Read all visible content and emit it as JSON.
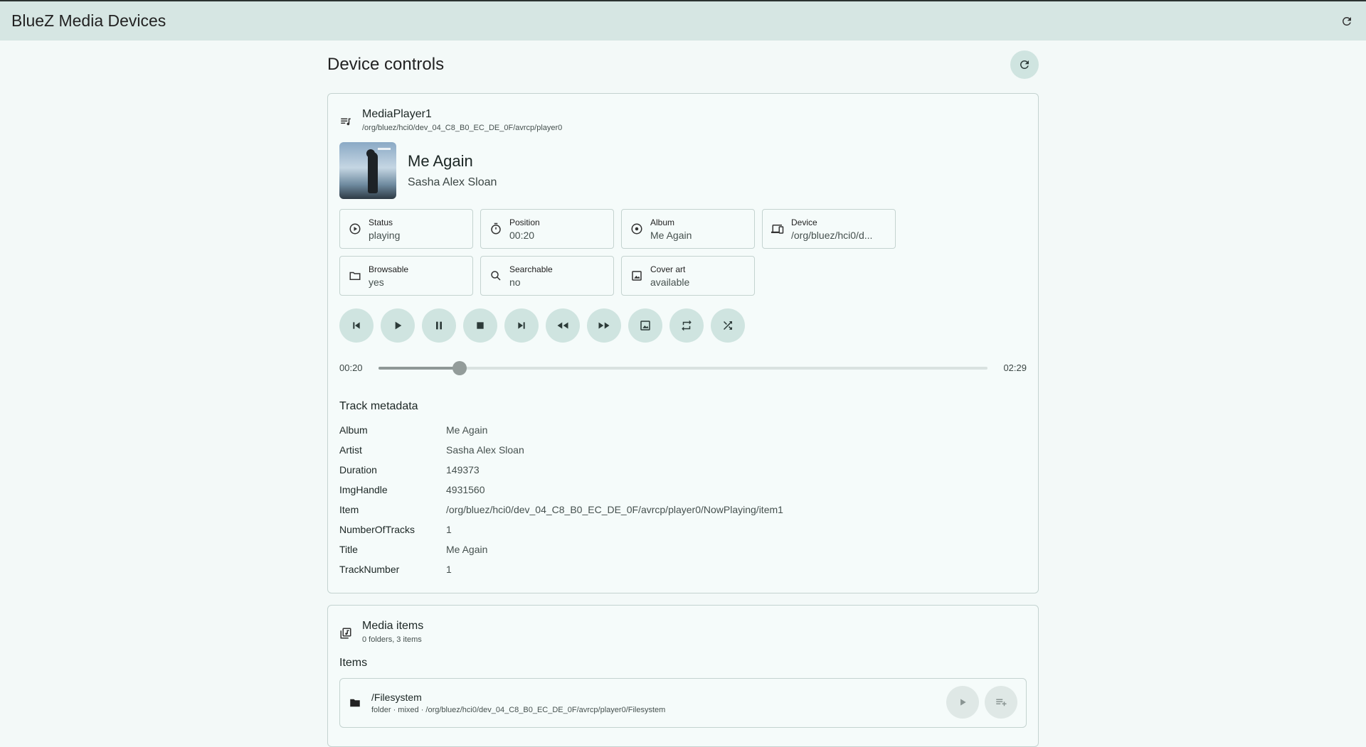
{
  "app": {
    "title": "BlueZ Media Devices"
  },
  "section": {
    "title": "Device controls"
  },
  "player": {
    "name": "MediaPlayer1",
    "path": "/org/bluez/hci0/dev_04_C8_B0_EC_DE_0F/avrcp/player0",
    "track_title": "Me Again",
    "track_artist": "Sasha Alex Sloan"
  },
  "chips": [
    {
      "label": "Status",
      "value": "playing",
      "icon": "play-circle-icon"
    },
    {
      "label": "Position",
      "value": "00:20",
      "icon": "timer-icon"
    },
    {
      "label": "Album",
      "value": "Me Again",
      "icon": "disc-icon"
    },
    {
      "label": "Device",
      "value": "/org/bluez/hci0/d...",
      "icon": "devices-icon"
    },
    {
      "label": "Browsable",
      "value": "yes",
      "icon": "folder-icon"
    },
    {
      "label": "Searchable",
      "value": "no",
      "icon": "search-icon"
    },
    {
      "label": "Cover art",
      "value": "available",
      "icon": "image-icon"
    }
  ],
  "controls": [
    "previous-icon",
    "play-icon",
    "pause-icon",
    "stop-icon",
    "next-icon",
    "rewind-icon",
    "fast-forward-icon",
    "image-icon",
    "repeat-icon",
    "shuffle-icon"
  ],
  "progress": {
    "current": "00:20",
    "total": "02:29",
    "fraction": 0.134
  },
  "metadata": {
    "title": "Track metadata",
    "rows": [
      {
        "key": "Album",
        "value": "Me Again"
      },
      {
        "key": "Artist",
        "value": "Sasha Alex Sloan"
      },
      {
        "key": "Duration",
        "value": "149373"
      },
      {
        "key": "ImgHandle",
        "value": "4931560"
      },
      {
        "key": "Item",
        "value": "/org/bluez/hci0/dev_04_C8_B0_EC_DE_0F/avrcp/player0/NowPlaying/item1"
      },
      {
        "key": "NumberOfTracks",
        "value": "1"
      },
      {
        "key": "Title",
        "value": "Me Again"
      },
      {
        "key": "TrackNumber",
        "value": "1"
      }
    ]
  },
  "media": {
    "title": "Media items",
    "subtitle": "0 folders, 3 items",
    "items_title": "Items",
    "items": [
      {
        "name": "/Filesystem",
        "sub": "folder · mixed · /org/bluez/hci0/dev_04_C8_B0_EC_DE_0F/avrcp/player0/Filesystem"
      }
    ]
  },
  "colors": {
    "appbar": "#d6e6e3",
    "button": "#cfe4e0",
    "background": "#f3f9f8"
  }
}
